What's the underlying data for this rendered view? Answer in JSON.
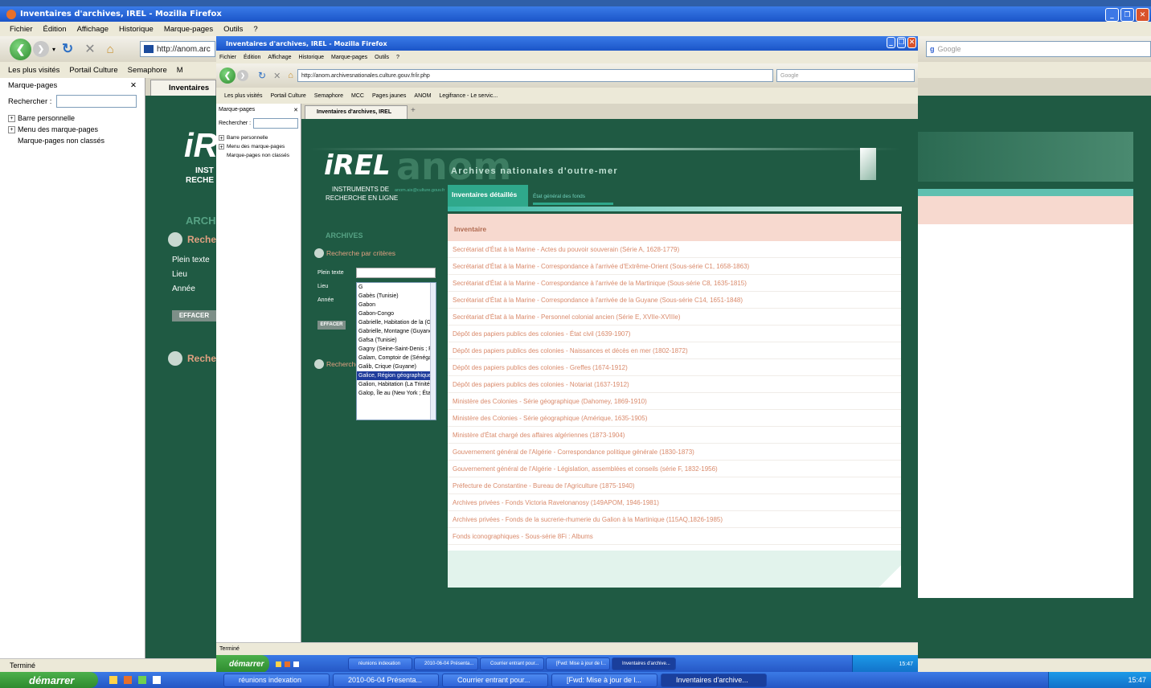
{
  "outer": {
    "title": "Inventaires d'archives, IREL - Mozilla Firefox",
    "menu": [
      "Fichier",
      "Édition",
      "Affichage",
      "Historique",
      "Marque-pages",
      "Outils",
      "?"
    ],
    "url": "http://anom.arc",
    "search_placeholder": "Google",
    "bookmarks": [
      "Les plus visités",
      "Portail Culture",
      "Semaphore",
      "M"
    ],
    "tab": "Inventaires",
    "sidebar_title": "Marque-pages",
    "search_label": "Rechercher :",
    "tree": [
      "Barre personnelle",
      "Menu des marque-pages",
      "Marque-pages non classés"
    ],
    "status": "Terminé",
    "page": {
      "logo": "iR",
      "logo_sub1": "INST",
      "logo_sub2": "RECHE",
      "archives": "ARCH",
      "recherche1": "Reche",
      "fields": [
        "Plein texte",
        "Lieu",
        "Année"
      ],
      "effacer": "EFFACER",
      "recherche2": "Reche"
    }
  },
  "inner": {
    "title": "Inventaires d'archives, IREL - Mozilla Firefox",
    "menu": [
      "Fichier",
      "Édition",
      "Affichage",
      "Historique",
      "Marque-pages",
      "Outils",
      "?"
    ],
    "url": "http://anom.archivesnationales.culture.gouv.fr/ir.php",
    "search_placeholder": "Google",
    "bookmarks": [
      "Les plus visités",
      "Portail Culture",
      "Semaphore",
      "MCC",
      "Pages jaunes",
      "ANOM",
      "Legifrance - Le servic..."
    ],
    "tab": "Inventaires d'archives, IREL",
    "sidebar_title": "Marque-pages",
    "search_label": "Rechercher :",
    "tree": [
      "Barre personnelle",
      "Menu des marque-pages",
      "Marque-pages non classés"
    ],
    "status": "Terminé",
    "page": {
      "irel": "iREL",
      "anom": "anom",
      "archives_nat": "Archives nationales d'outre-mer",
      "instruments1": "INSTRUMENTS DE",
      "instruments2": "RECHERCHE EN LIGNE",
      "email": "anom.aix@culture.gouv.fr",
      "tab_active": "Inventaires détaillés",
      "tab_other": "État général des fonds",
      "archives_label": "ARCHIVES",
      "recherche_criteres": "Recherche par critères",
      "fields": [
        "Plein texte",
        "Lieu",
        "Année"
      ],
      "effacer": "EFFACER",
      "recherche2": "Recherche",
      "dropdown_items": [
        "G",
        "Gabès (Tunisie)",
        "Gabon",
        "Gabon-Congo",
        "Gabrielle, Habitation de la (Guyane",
        "Gabrielle, Montagne (Guyane)",
        "Gafsa (Tunisie)",
        "Gagny (Seine-Saint-Denis ; France)",
        "Galam, Comptoir de (Sénégal)",
        "Galib, Crique (Guyane)",
        "Galice, Région géographique (Espagne)",
        "Galion, Habitation (La Trinité ; Martinique, Île de la)",
        "Galop, Île au (New York ; États-Unis"
      ],
      "dropdown_selected": 10,
      "inventaire_header": "Inventaire",
      "inventaire_rows": [
        "Secrétariat d'État à la Marine - Actes du pouvoir souverain (Série A, 1628-1779)",
        "Secrétariat d'État à la Marine - Correspondance à l'arrivée d'Extrême-Orient (Sous-série C1, 1658-1863)",
        "Secrétariat d'État à la Marine - Correspondance à l'arrivée de la Martinique (Sous-série C8, 1635-1815)",
        "Secrétariat d'État à la Marine - Correspondance à l'arrivée de la Guyane (Sous-série C14, 1651-1848)",
        "Secrétariat d'État à la Marine - Personnel colonial ancien (Série E, XVIIe-XVIIIe)",
        "Dépôt des papiers publics des colonies - État civil (1639-1907)",
        "Dépôt des papiers publics des colonies - Naissances et décès en mer (1802-1872)",
        "Dépôt des papiers publics des colonies - Greffes (1674-1912)",
        "Dépôt des papiers publics des colonies - Notariat (1637-1912)",
        "Ministère des Colonies - Série géographique (Dahomey, 1869-1910)",
        "Ministère des Colonies - Série géographique (Amérique, 1635-1905)",
        "Ministère d'État chargé des affaires algériennes (1873-1904)",
        "Gouvernement général de l'Algérie - Correspondance politique générale (1830-1873)",
        "Gouvernement général de l'Algérie - Législation, assemblées et conseils (série F, 1832-1956)",
        "Préfecture de Constantine - Bureau de l'Agriculture (1875-1940)",
        "Archives privées - Fonds Victoria Ravelonanosy (149APOM, 1946-1981)",
        "Archives privées - Fonds de la sucrerie-rhumerie du Galion à la Martinique (115AQ,1826-1985)",
        "Fonds iconographiques - Sous-série 8Fi : Albums"
      ]
    }
  },
  "taskbar_inner": {
    "start": "démarrer",
    "tasks": [
      "réunions indexation",
      "2010-06-04 Présenta...",
      "Courrier entrant pour...",
      "[Fwd: Mise à jour de l...",
      "Inventaires d'archive..."
    ],
    "clock": "15:47"
  },
  "taskbar_outer": {
    "start": "démarrer",
    "tasks": [
      "réunions indexation",
      "2010-06-04 Présenta...",
      "Courrier entrant pour...",
      "[Fwd: Mise à jour de l...",
      "Inventaires d'archive..."
    ],
    "clock": "15:47"
  },
  "colors": {
    "green": "#1f5a43",
    "accent": "#2ea889",
    "rose": "#f7d9cf",
    "link": "#d9896a"
  }
}
